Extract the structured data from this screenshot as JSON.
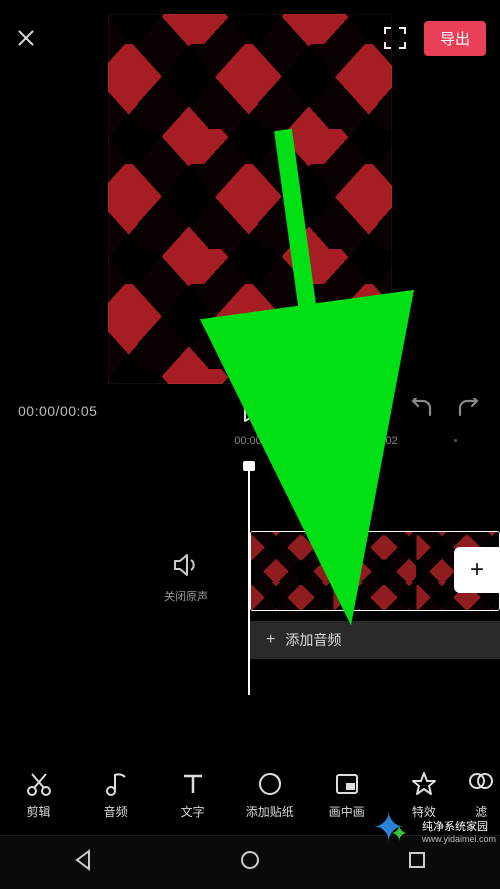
{
  "header": {
    "export_label": "导出"
  },
  "transport": {
    "time_current": "00:00",
    "time_total": "00:05"
  },
  "ruler": {
    "ticks": [
      "00:00",
      "00:02"
    ]
  },
  "mute": {
    "label": "关闭原声"
  },
  "audio": {
    "add_label": "添加音频"
  },
  "tools": [
    {
      "id": "cut",
      "label": "剪辑"
    },
    {
      "id": "audio",
      "label": "音频"
    },
    {
      "id": "text",
      "label": "文字"
    },
    {
      "id": "sticker",
      "label": "添加贴纸"
    },
    {
      "id": "pip",
      "label": "画中画"
    },
    {
      "id": "fx",
      "label": "特效"
    },
    {
      "id": "filter",
      "label": "滤"
    }
  ],
  "watermark": {
    "title": "纯净系统家园",
    "url": "www.yidaimei.com"
  }
}
